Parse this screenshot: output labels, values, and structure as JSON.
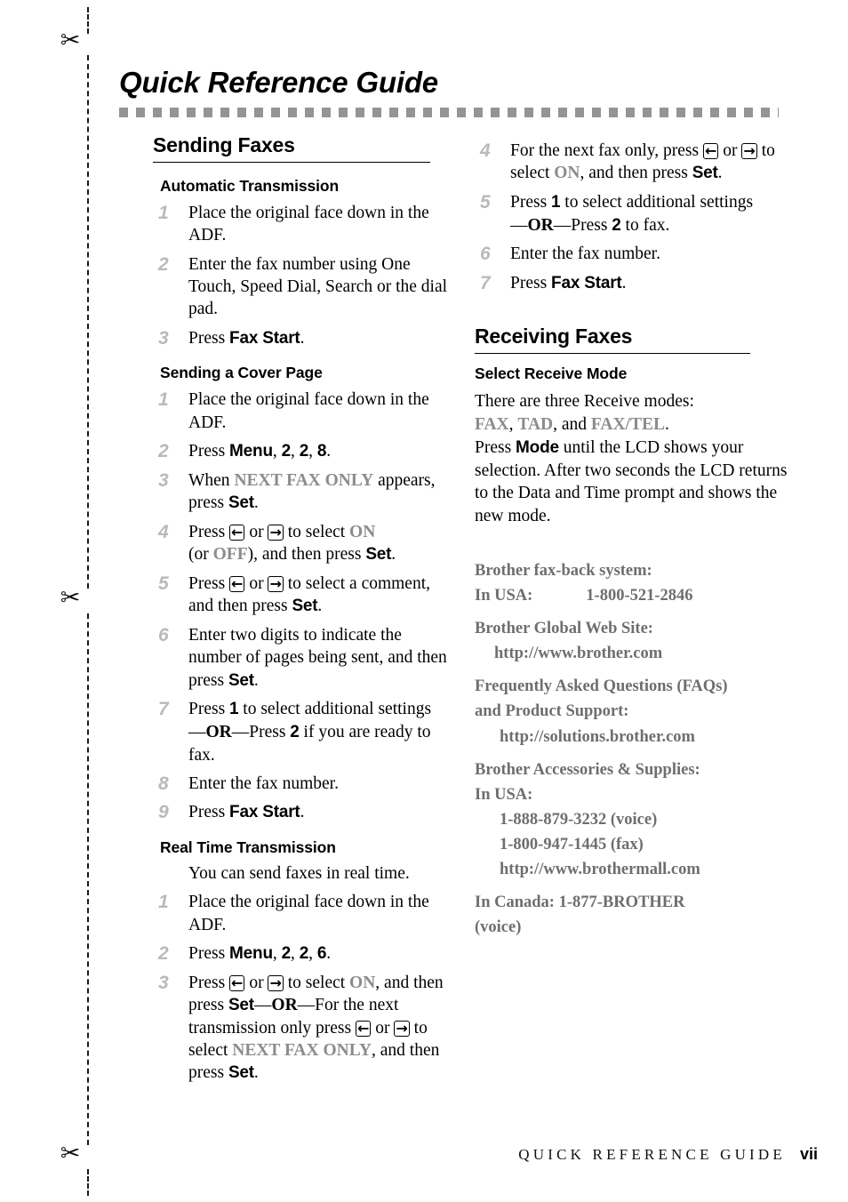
{
  "page": {
    "title": "Quick Reference Guide",
    "footer_title": "QUICK REFERENCE GUIDE",
    "footer_page": "vii"
  },
  "margin": {
    "scissors_glyph": "✂"
  },
  "icons": {
    "left_arrow": "←",
    "right_arrow": "→"
  },
  "left_column": {
    "section_title": "Sending Faxes",
    "groups": [
      {
        "heading": "Automatic Transmission",
        "steps": [
          {
            "num": "1",
            "text": "Place the original face down in the ADF."
          },
          {
            "num": "2",
            "text": "Enter the fax number using One Touch, Speed Dial, Search or the dial pad."
          },
          {
            "num": "3",
            "text": "Press Fax Start."
          }
        ]
      },
      {
        "heading": "Sending a Cover Page",
        "steps": [
          {
            "num": "1",
            "text": "Place the original face down in the ADF."
          },
          {
            "num": "2",
            "text": "Press Menu, 2, 2, 8."
          },
          {
            "num": "3",
            "text": "When NEXT FAX ONLY appears, press Set."
          },
          {
            "num": "4",
            "text": "Press ← or → to select ON (or OFF), and then press Set."
          },
          {
            "num": "5",
            "text": "Press ← or → to select a comment, and then press Set."
          },
          {
            "num": "6",
            "text": "Enter two digits to indicate the number of pages being sent, and then press Set."
          },
          {
            "num": "7",
            "text": "Press 1 to select additional settings —OR—Press 2 if you are ready to fax."
          },
          {
            "num": "8",
            "text": "Enter the fax number."
          },
          {
            "num": "9",
            "text": "Press Fax Start."
          }
        ]
      },
      {
        "heading": "Real Time Transmission",
        "intro": "You can send faxes in real time.",
        "steps": [
          {
            "num": "1",
            "text": "Place the original face down in the ADF."
          },
          {
            "num": "2",
            "text": "Press Menu, 2, 2, 6."
          },
          {
            "num": "3",
            "text": "Press ← or → to select ON, and then press Set—OR—For the next transmission only press ← or → to select NEXT FAX ONLY, and then press Set."
          }
        ]
      }
    ]
  },
  "right_column": {
    "continued_steps": [
      {
        "num": "4",
        "text": "For the next fax only, press ← or → to select ON, and then press Set."
      },
      {
        "num": "5",
        "text": "Press 1 to select additional settings —OR—Press 2 to fax."
      },
      {
        "num": "6",
        "text": "Enter the fax number."
      },
      {
        "num": "7",
        "text": "Press Fax Start."
      }
    ],
    "section_title": "Receiving Faxes",
    "subheading": "Select Receive Mode",
    "body": "There are three Receive modes: FAX, TAD, and FAX/TEL. Press Mode until the LCD shows your selection. After two seconds the LCD returns to the Data and Time prompt and shows the new mode.",
    "contact": {
      "faxback_label": "Brother fax-back system:",
      "faxback_usa_label": "In USA:",
      "faxback_usa_number": "1-800-521-2846",
      "global_web_label": "Brother Global Web Site:",
      "global_web_url": "http://www.brother.com",
      "faq_label_line1": "Frequently Asked Questions (FAQs)",
      "faq_label_line2": "and Product Support:",
      "faq_url": "http://solutions.brother.com",
      "accessories_label": "Brother Accessories & Supplies:",
      "accessories_usa_label": "In USA:",
      "accessories_voice": "1-888-879-3232 (voice)",
      "accessories_fax": "1-800-947-1445 (fax)",
      "accessories_url": "http://www.brothermall.com",
      "canada_line1": "In Canada: 1-877-BROTHER",
      "canada_line2": "(voice)"
    }
  }
}
